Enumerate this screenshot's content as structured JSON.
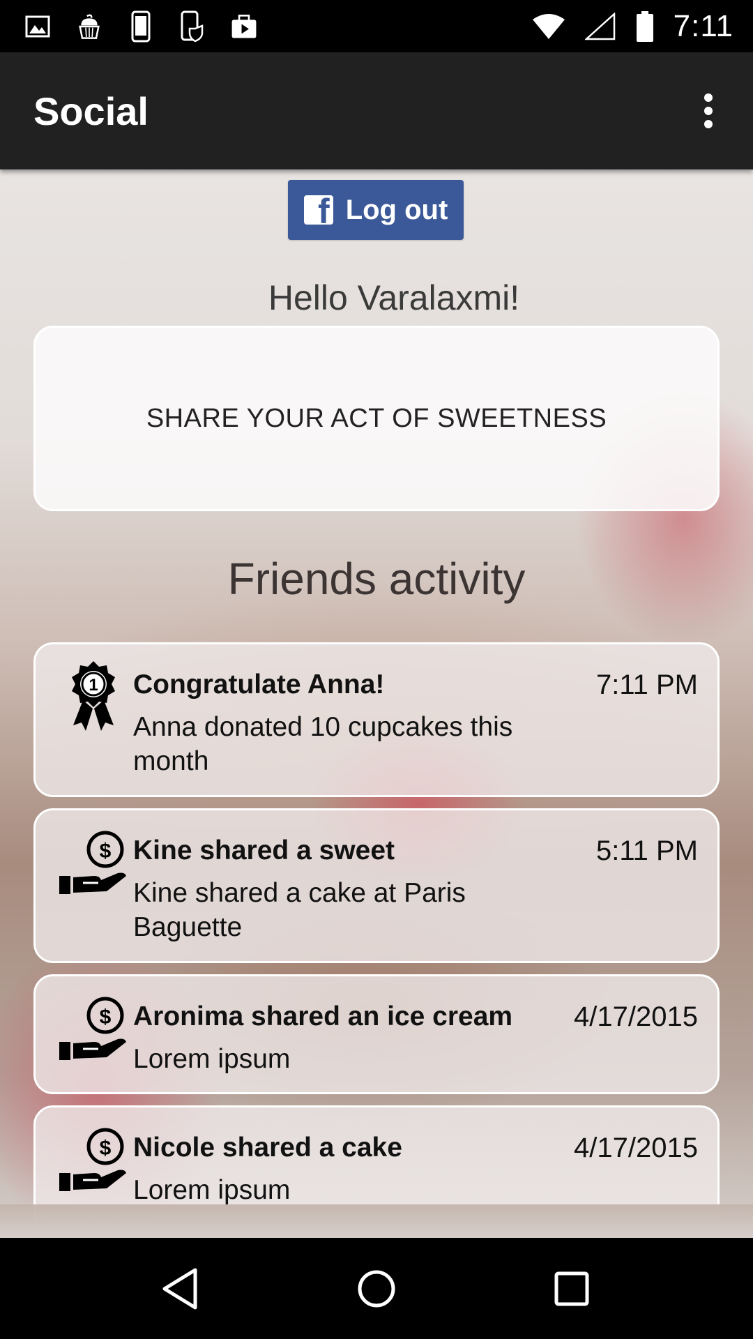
{
  "status_bar": {
    "time": "7:11",
    "left_icons": [
      "image-icon",
      "cupcake-icon",
      "phone-icon",
      "phone-shield-icon",
      "briefcase-play-icon"
    ],
    "right_icons": [
      "wifi-icon",
      "signal-icon",
      "battery-icon"
    ]
  },
  "app_bar": {
    "title": "Social",
    "menu_icon": "overflow-menu-icon"
  },
  "facebook": {
    "logout_label": "Log out",
    "brand_color": "#3b5998"
  },
  "greeting": "Hello Varalaxmi!",
  "share_card": {
    "label": "SHARE YOUR ACT OF SWEETNESS"
  },
  "activity": {
    "heading": "Friends activity",
    "items": [
      {
        "icon": "award-ribbon-icon",
        "title": "Congratulate Anna!",
        "time": "7:11 PM",
        "description": "Anna donated 10 cupcakes this month"
      },
      {
        "icon": "hand-coin-icon",
        "title": "Kine shared a sweet",
        "time": "5:11 PM",
        "description": "Kine shared a cake at Paris Baguette"
      },
      {
        "icon": "hand-coin-icon",
        "title": "Aronima shared an ice cream",
        "time": "4/17/2015",
        "description": "Lorem ipsum"
      },
      {
        "icon": "hand-coin-icon",
        "title": "Nicole shared a cake",
        "time": "4/17/2015",
        "description": "Lorem ipsum"
      }
    ]
  },
  "nav_bar": {
    "buttons": [
      "back-icon",
      "home-icon",
      "recents-icon"
    ]
  }
}
